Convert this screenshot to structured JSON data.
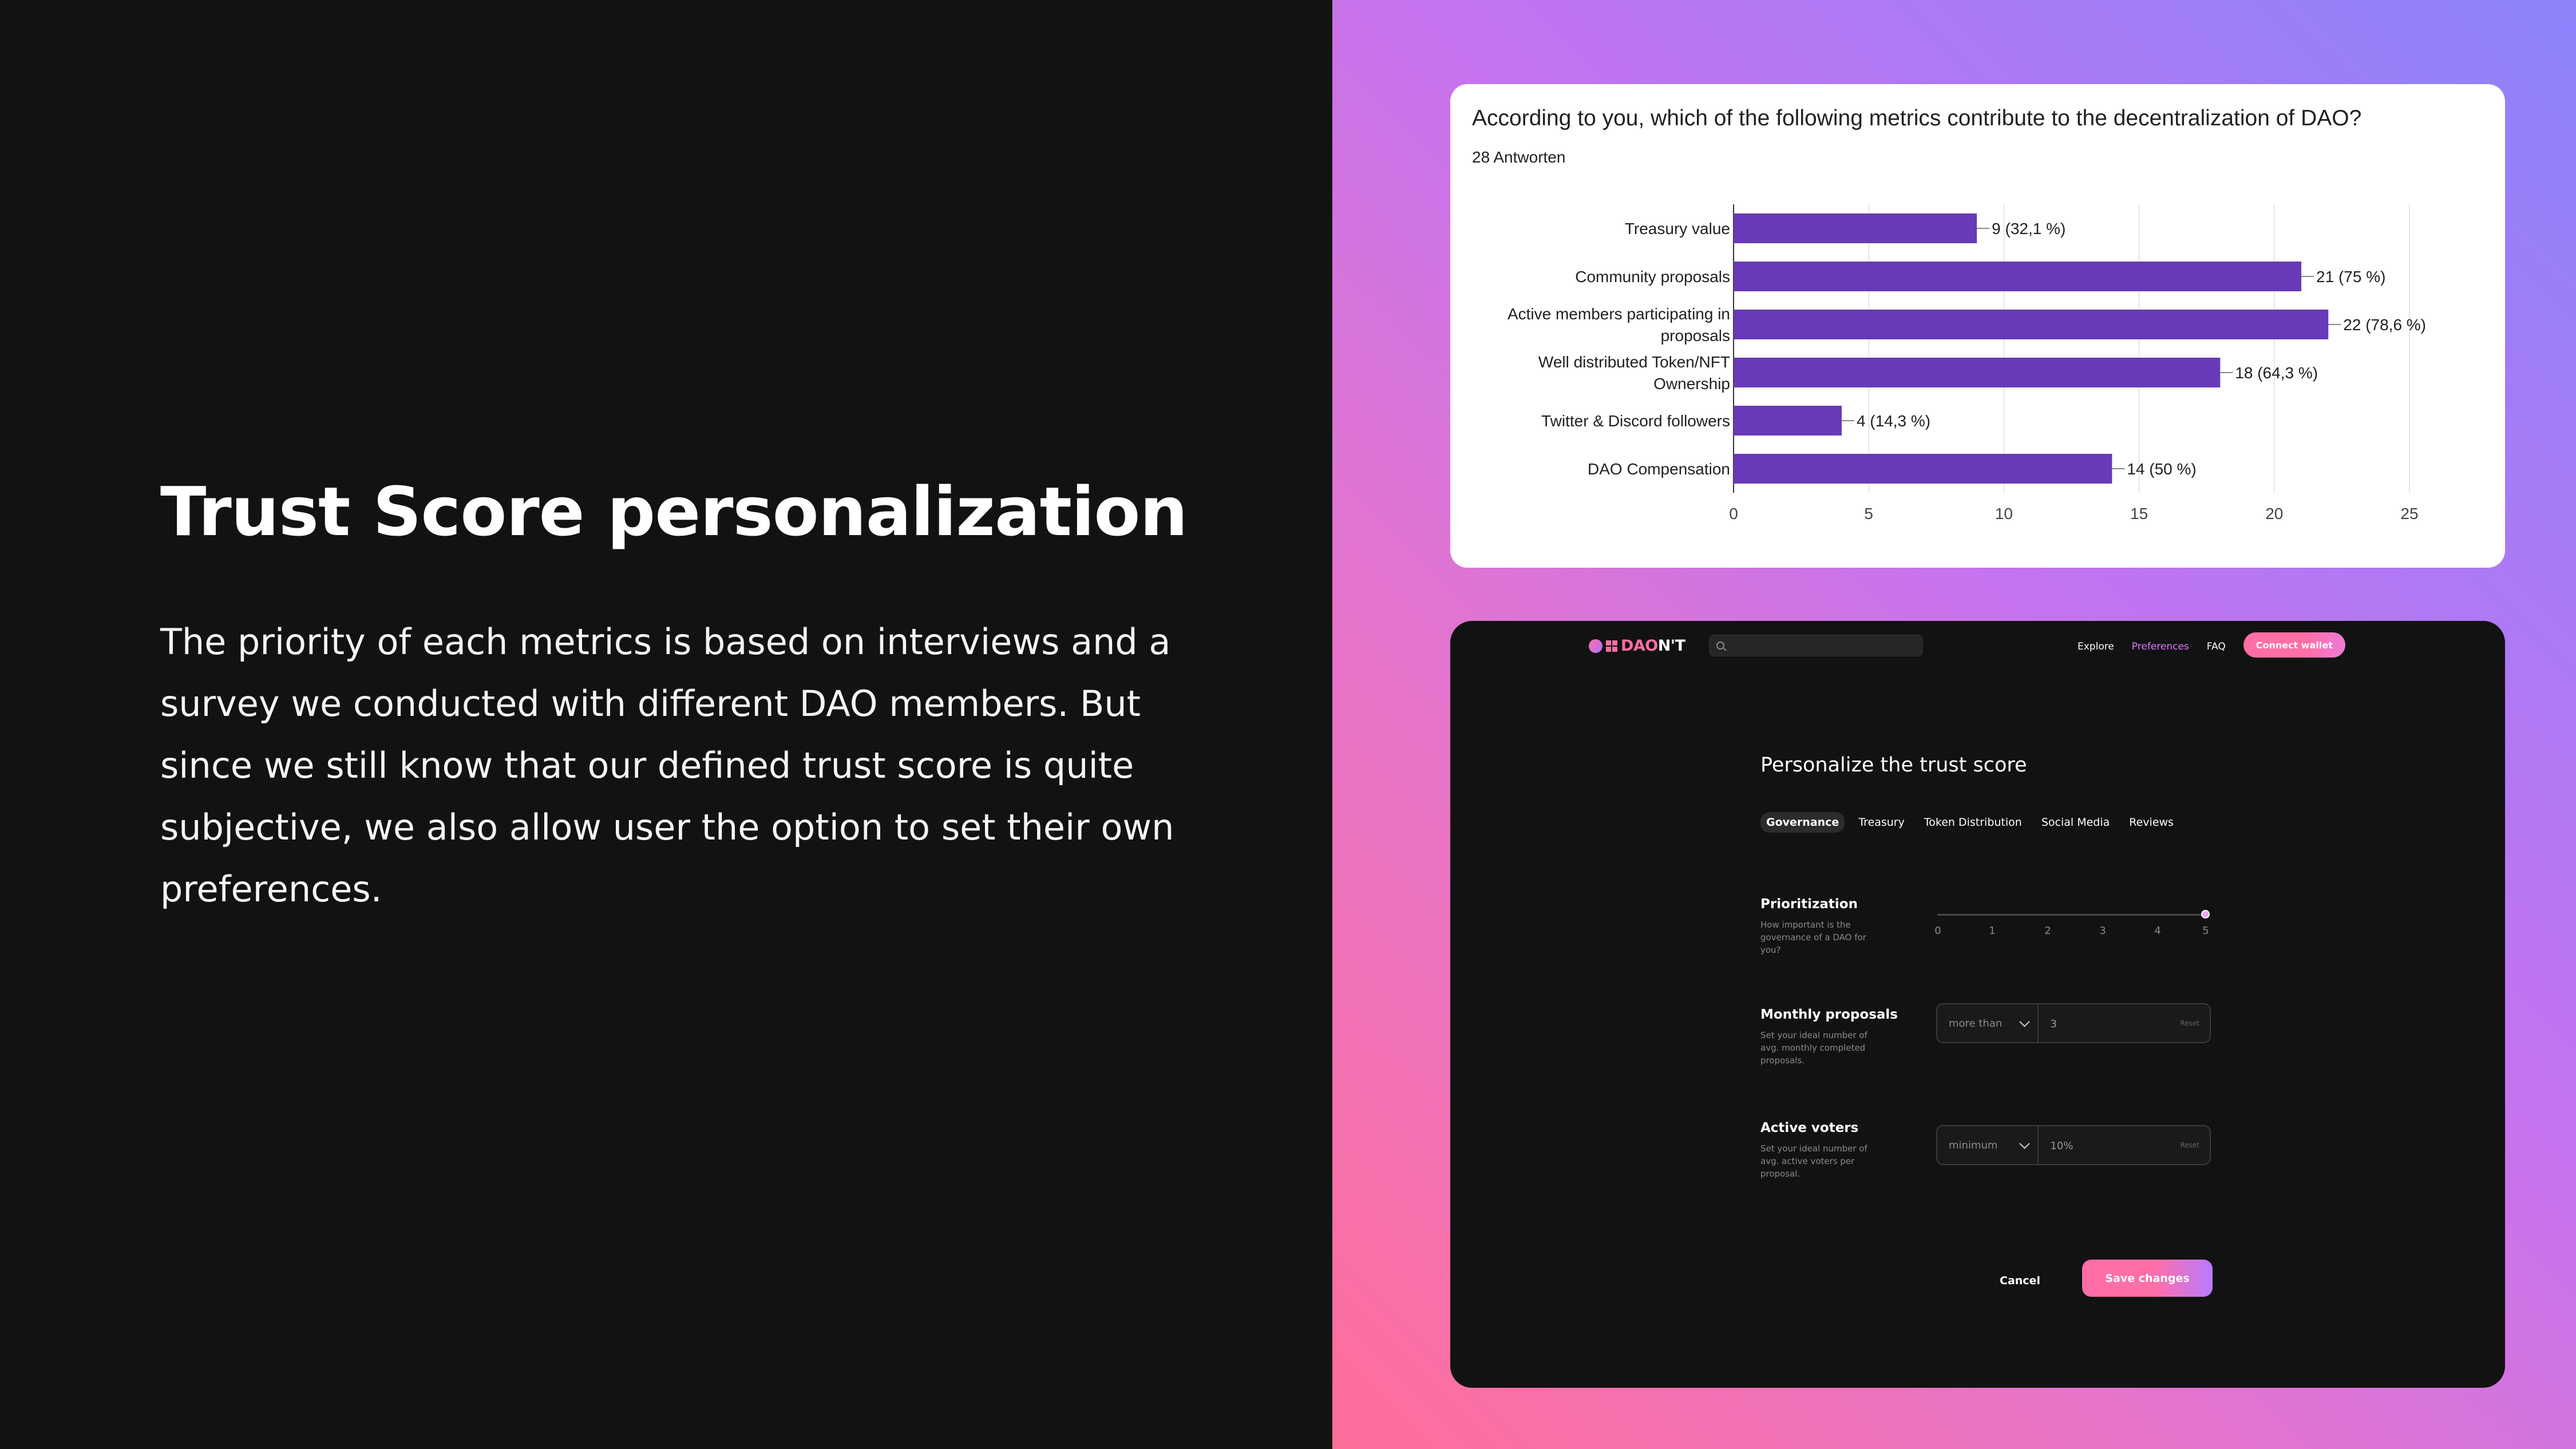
{
  "slide": {
    "title": "Trust Score personalization",
    "body": "The priority of each metrics is based on interviews and a survey we conducted with different DAO members. But since we still know that our defined trust score is quite subjective, we also allow user the option to set their own preferences."
  },
  "survey": {
    "question": "According to you, which of the following metrics contribute to the decentralization of DAO?",
    "responses": "28 Antworten",
    "bar_color": "#673ab7"
  },
  "chart_data": {
    "type": "bar",
    "orientation": "horizontal",
    "categories": [
      [
        "Treasury value"
      ],
      [
        "Community proposals"
      ],
      [
        "Active members participating in",
        "proposals"
      ],
      [
        "Well distributed Token/NFT",
        "Ownership"
      ],
      [
        "Twitter & Discord followers"
      ],
      [
        "DAO Compensation"
      ]
    ],
    "values": [
      9,
      21,
      22,
      18,
      4,
      14
    ],
    "value_labels": [
      "9 (32,1 %)",
      "21 (75 %)",
      "22 (78,6 %)",
      "18 (64,3 %)",
      "4 (14,3 %)",
      "14 (50 %)"
    ],
    "xlim": [
      0,
      25
    ],
    "xticks": [
      0,
      5,
      10,
      15,
      20,
      25
    ],
    "grid": true
  },
  "app": {
    "logo": {
      "brand": "DAO",
      "suffix": "N'T"
    },
    "search": {
      "placeholder": ""
    },
    "nav": [
      {
        "label": "Explore"
      },
      {
        "label": "Preferences",
        "active": true
      },
      {
        "label": "FAQ"
      }
    ],
    "connect_label": "Connect wallet",
    "heading": "Personalize the trust score",
    "tabs": [
      {
        "label": "Governance",
        "active": true
      },
      {
        "label": "Treasury"
      },
      {
        "label": "Token Distribution"
      },
      {
        "label": "Social Media"
      },
      {
        "label": "Reviews"
      }
    ],
    "prioritization": {
      "label": "Prioritization",
      "desc": "How important is the governance of a DAO for you?",
      "ticks": [
        "0",
        "1",
        "2",
        "3",
        "4",
        "5"
      ],
      "value": 5
    },
    "monthly_proposals": {
      "label": "Monthly proposals",
      "desc": "Set your ideal number of avg. monthly completed proposals.",
      "select": "more than",
      "value": "3",
      "reset": "Reset"
    },
    "active_voters": {
      "label": "Active voters",
      "desc": "Set your ideal number of avg. active voters per proposal.",
      "select": "minimum",
      "value": "10%",
      "reset": "Reset"
    },
    "cancel_label": "Cancel",
    "save_label": "Save changes",
    "accent": "#ff6ea6"
  }
}
